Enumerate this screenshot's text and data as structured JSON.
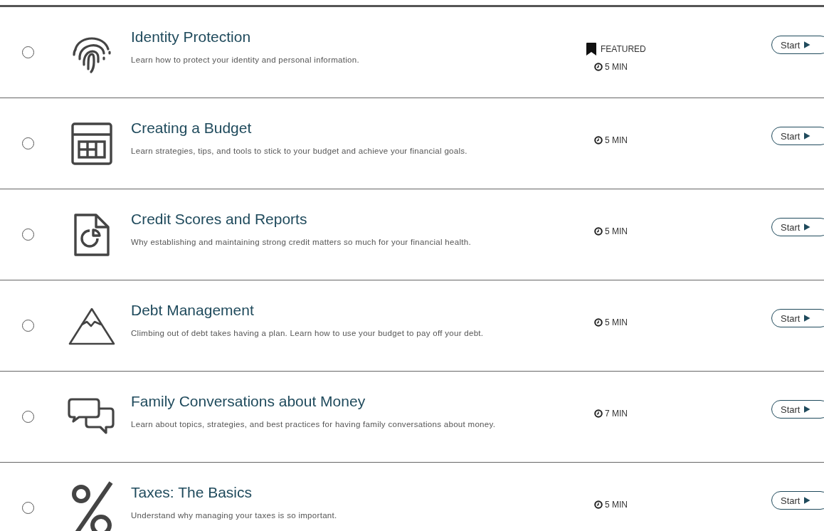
{
  "courses": [
    {
      "kind": "fingerprint",
      "selected": false,
      "title": "Identity Protection",
      "description": "Learn how to protect your identity and personal information.",
      "badge": "FEATURED",
      "duration": "5 MIN",
      "button": "Start"
    },
    {
      "kind": "calendar",
      "selected": false,
      "title": "Creating a Budget",
      "description": "Learn strategies, tips, and tools to stick to your budget and achieve your financial goals.",
      "duration": "5 MIN",
      "button": "Start"
    },
    {
      "kind": "report",
      "selected": false,
      "title": "Credit Scores and Reports",
      "description": "Why establishing and maintaining strong credit matters so much for your financial health.",
      "duration": "5 MIN",
      "button": "Start"
    },
    {
      "kind": "mountain",
      "selected": false,
      "title": "Debt Management",
      "description": "Climbing out of debt takes having a plan. Learn how to use your budget to pay off your debt.",
      "duration": "5 MIN",
      "button": "Start"
    },
    {
      "kind": "chat",
      "selected": false,
      "title": "Family Conversations about Money",
      "description": "Learn about topics, strategies, and best practices for having family conversations about money.",
      "duration": "7 MIN",
      "button": "Start"
    },
    {
      "kind": "percent",
      "selected": false,
      "title": "Taxes: The Basics",
      "description": "Understand why managing your taxes is so important.",
      "duration": "5 MIN",
      "button": "Start"
    }
  ]
}
